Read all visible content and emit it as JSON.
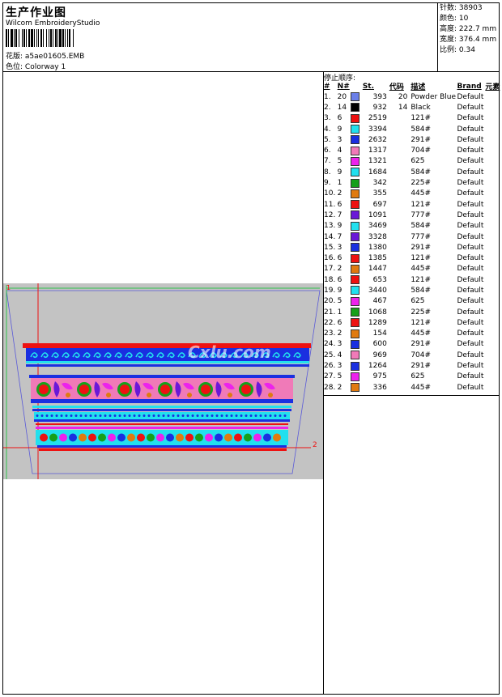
{
  "header": {
    "title": "生产作业图",
    "software": "Wilcom EmbroideryStudio",
    "design_label": "花版:",
    "design_value": "a5ae01605.EMB",
    "colorway_label": "色位:",
    "colorway_value": "Colorway 1"
  },
  "specs": [
    {
      "label": "针数:",
      "value": "38903"
    },
    {
      "label": "颜色:",
      "value": "10"
    },
    {
      "label": "高度:",
      "value": "222.7 mm"
    },
    {
      "label": "宽度:",
      "value": "376.4 mm"
    },
    {
      "label": "比例:",
      "value": "0.34"
    }
  ],
  "stop_list": {
    "title": "停止顺序:",
    "headers": {
      "idx": "#",
      "stops": "N#",
      "st": "St.",
      "code": "代码",
      "desc": "描述",
      "brand": "Brand",
      "element": "元素"
    },
    "rows": [
      {
        "idx": "1.",
        "n": "20",
        "color": "#6b7fe8",
        "st": "393",
        "code": "20",
        "desc": "Powder Blue",
        "brand": "Default"
      },
      {
        "idx": "2.",
        "n": "14",
        "color": "#000000",
        "st": "932",
        "code": "14",
        "desc": "Black",
        "brand": "Default"
      },
      {
        "idx": "3.",
        "n": "6",
        "color": "#ee1111",
        "st": "2519",
        "code": "",
        "desc": "121#",
        "brand": "Default"
      },
      {
        "idx": "4.",
        "n": "9",
        "color": "#22e0ee",
        "st": "3394",
        "code": "",
        "desc": "584#",
        "brand": "Default"
      },
      {
        "idx": "5.",
        "n": "3",
        "color": "#1a2fe0",
        "st": "2632",
        "code": "",
        "desc": "291#",
        "brand": "Default"
      },
      {
        "idx": "6.",
        "n": "4",
        "color": "#f07ab8",
        "st": "1317",
        "code": "",
        "desc": "704#",
        "brand": "Default"
      },
      {
        "idx": "7.",
        "n": "5",
        "color": "#ec22ec",
        "st": "1321",
        "code": "",
        "desc": "625",
        "brand": "Default"
      },
      {
        "idx": "8.",
        "n": "9",
        "color": "#22e0ee",
        "st": "1684",
        "code": "",
        "desc": "584#",
        "brand": "Default"
      },
      {
        "idx": "9.",
        "n": "1",
        "color": "#16a01a",
        "st": "342",
        "code": "",
        "desc": "225#",
        "brand": "Default"
      },
      {
        "idx": "10.",
        "n": "2",
        "color": "#e07a10",
        "st": "355",
        "code": "",
        "desc": "445#",
        "brand": "Default"
      },
      {
        "idx": "11.",
        "n": "6",
        "color": "#ee1111",
        "st": "697",
        "code": "",
        "desc": "121#",
        "brand": "Default"
      },
      {
        "idx": "12.",
        "n": "7",
        "color": "#6a18d8",
        "st": "1091",
        "code": "",
        "desc": "777#",
        "brand": "Default"
      },
      {
        "idx": "13.",
        "n": "9",
        "color": "#22e0ee",
        "st": "3469",
        "code": "",
        "desc": "584#",
        "brand": "Default"
      },
      {
        "idx": "14.",
        "n": "7",
        "color": "#6a18d8",
        "st": "3328",
        "code": "",
        "desc": "777#",
        "brand": "Default"
      },
      {
        "idx": "15.",
        "n": "3",
        "color": "#1a2fe0",
        "st": "1380",
        "code": "",
        "desc": "291#",
        "brand": "Default"
      },
      {
        "idx": "16.",
        "n": "6",
        "color": "#ee1111",
        "st": "1385",
        "code": "",
        "desc": "121#",
        "brand": "Default"
      },
      {
        "idx": "17.",
        "n": "2",
        "color": "#e07a10",
        "st": "1447",
        "code": "",
        "desc": "445#",
        "brand": "Default"
      },
      {
        "idx": "18.",
        "n": "6",
        "color": "#ee1111",
        "st": "653",
        "code": "",
        "desc": "121#",
        "brand": "Default"
      },
      {
        "idx": "19.",
        "n": "9",
        "color": "#22e0ee",
        "st": "3440",
        "code": "",
        "desc": "584#",
        "brand": "Default"
      },
      {
        "idx": "20.",
        "n": "5",
        "color": "#ec22ec",
        "st": "467",
        "code": "",
        "desc": "625",
        "brand": "Default"
      },
      {
        "idx": "21.",
        "n": "1",
        "color": "#16a01a",
        "st": "1068",
        "code": "",
        "desc": "225#",
        "brand": "Default"
      },
      {
        "idx": "22.",
        "n": "6",
        "color": "#ee1111",
        "st": "1289",
        "code": "",
        "desc": "121#",
        "brand": "Default"
      },
      {
        "idx": "23.",
        "n": "2",
        "color": "#e07a10",
        "st": "154",
        "code": "",
        "desc": "445#",
        "brand": "Default"
      },
      {
        "idx": "24.",
        "n": "3",
        "color": "#1a2fe0",
        "st": "600",
        "code": "",
        "desc": "291#",
        "brand": "Default"
      },
      {
        "idx": "25.",
        "n": "4",
        "color": "#f07ab8",
        "st": "969",
        "code": "",
        "desc": "704#",
        "brand": "Default"
      },
      {
        "idx": "26.",
        "n": "3",
        "color": "#1a2fe0",
        "st": "1264",
        "code": "",
        "desc": "291#",
        "brand": "Default"
      },
      {
        "idx": "27.",
        "n": "5",
        "color": "#ec22ec",
        "st": "975",
        "code": "",
        "desc": "625",
        "brand": "Default"
      },
      {
        "idx": "28.",
        "n": "2",
        "color": "#e07a10",
        "st": "336",
        "code": "",
        "desc": "445#",
        "brand": "Default"
      }
    ]
  },
  "preview": {
    "marker_start": "1",
    "marker_end": "2",
    "watermark": "Cxlu.com"
  }
}
